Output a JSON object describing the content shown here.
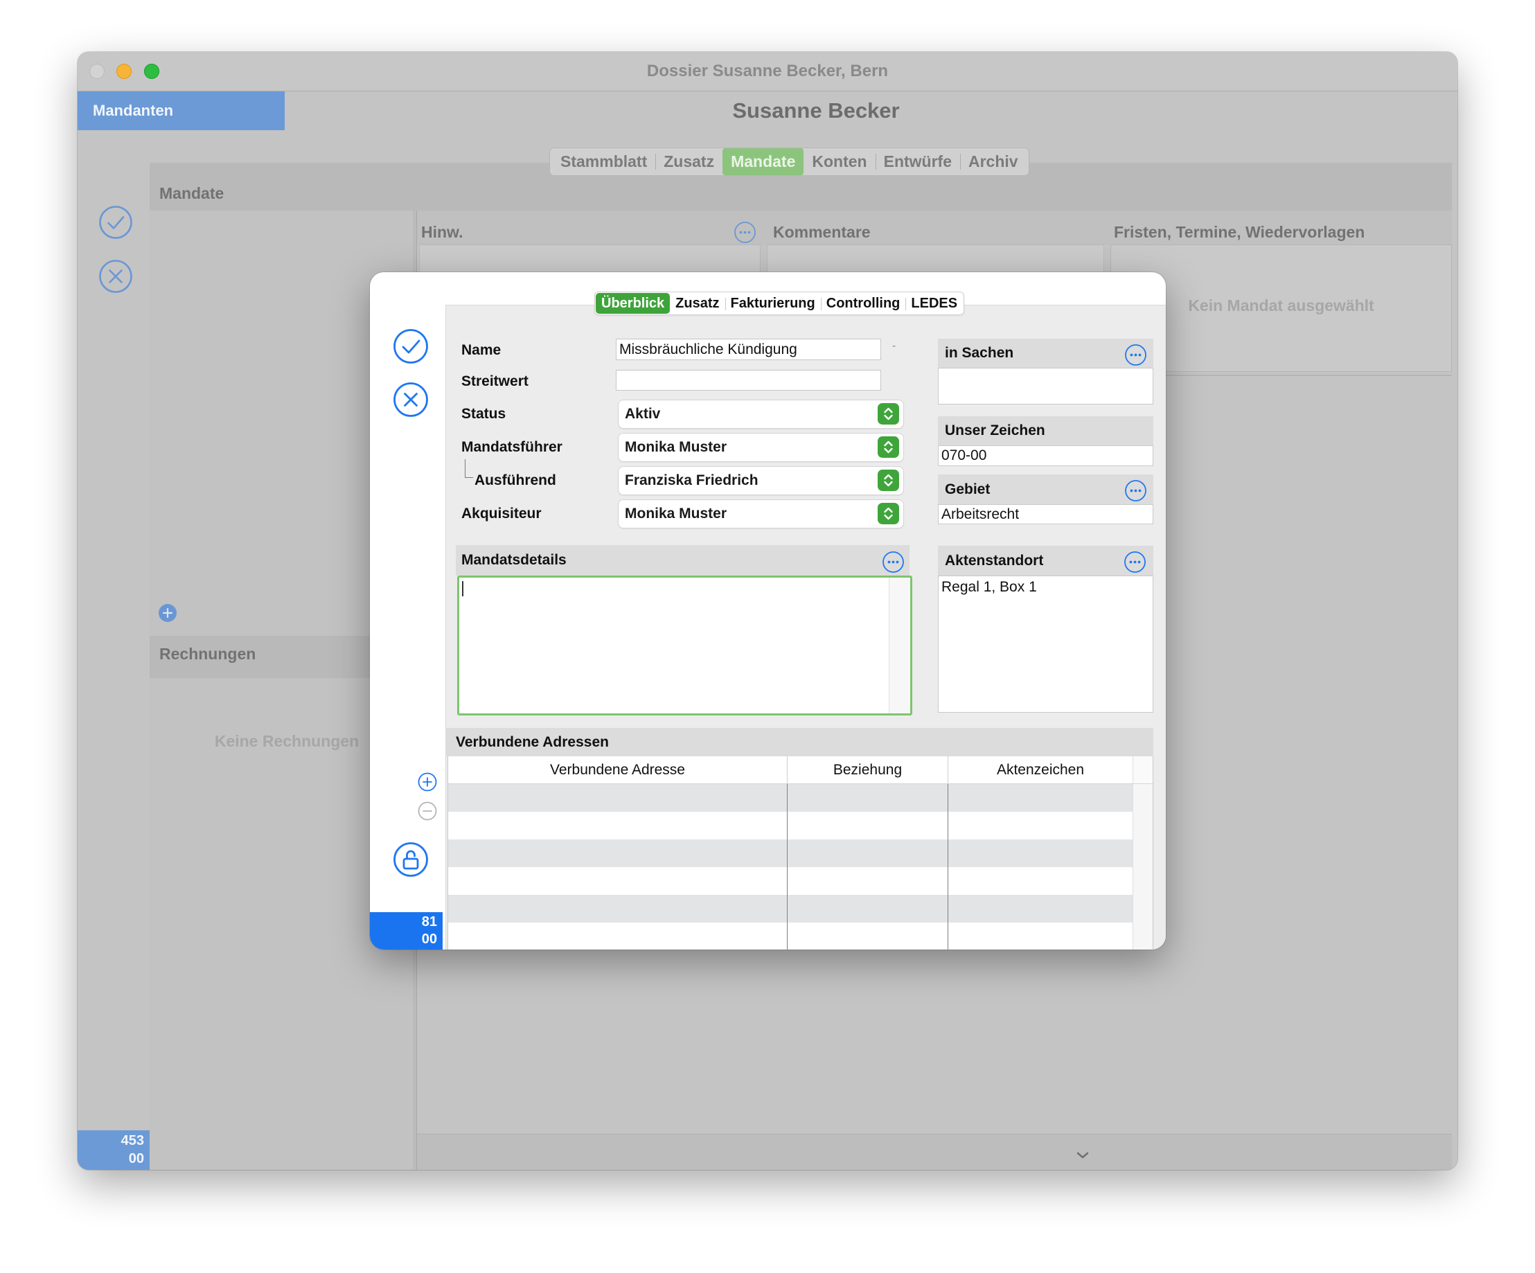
{
  "window": {
    "title": "Dossier Susanne Becker, Bern"
  },
  "sidebar": {
    "tab_label": "Mandanten",
    "badge": {
      "line1": "453",
      "line2": "00"
    }
  },
  "header": {
    "title": "Susanne Becker"
  },
  "main_tabs": [
    {
      "label": "Stammblatt",
      "selected": false
    },
    {
      "label": "Zusatz",
      "selected": false
    },
    {
      "label": "Mandate",
      "selected": true
    },
    {
      "label": "Konten",
      "selected": false
    },
    {
      "label": "Entwürfe",
      "selected": false
    },
    {
      "label": "Archiv",
      "selected": false
    }
  ],
  "mandate_panel": {
    "title": "Mandate"
  },
  "invoices_panel": {
    "title": "Rechnungen",
    "empty_text": "Keine Rechnungen"
  },
  "detail_sections": {
    "hints": "Hinw.",
    "comments": "Kommentare",
    "deadlines": "Fristen, Termine, Wiedervorlagen",
    "empty_text": "Kein Mandat ausgewählt"
  },
  "modal": {
    "tabs": [
      {
        "label": "Überblick",
        "selected": true
      },
      {
        "label": "Zusatz",
        "selected": false
      },
      {
        "label": "Fakturierung",
        "selected": false
      },
      {
        "label": "Controlling",
        "selected": false
      },
      {
        "label": "LEDES",
        "selected": false
      }
    ],
    "badge": {
      "line1": "81",
      "line2": "00"
    },
    "form": {
      "name": {
        "label": "Name",
        "value": "Missbräuchliche Kündigung",
        "suffix": "-"
      },
      "streitwert": {
        "label": "Streitwert",
        "value": ""
      },
      "status": {
        "label": "Status",
        "value": "Aktiv"
      },
      "mandatsfuehrer": {
        "label": "Mandatsführer",
        "value": "Monika Muster"
      },
      "ausfuehrend": {
        "label": "Ausführend",
        "value": "Franziska Friedrich"
      },
      "akquisiteur": {
        "label": "Akquisiteur",
        "value": "Monika Muster"
      }
    },
    "details": {
      "label": "Mandatsdetails",
      "value": ""
    },
    "in_sachen": {
      "label": "in Sachen",
      "value": ""
    },
    "unser_zeichen": {
      "label": "Unser Zeichen",
      "value": "070-00"
    },
    "gebiet": {
      "label": "Gebiet",
      "value": "Arbeitsrecht"
    },
    "aktenstandort": {
      "label": "Aktenstandort",
      "value": "Regal 1, Box 1"
    },
    "linked_addresses": {
      "title": "Verbundene Adressen",
      "columns": [
        "Verbundene Adresse",
        "Beziehung",
        "Aktenzeichen"
      ]
    }
  },
  "icons": {
    "confirm": "check-circle-icon",
    "cancel": "x-circle-icon",
    "more": "ellipsis-circle-icon",
    "add": "plus-circle-icon",
    "remove": "minus-circle-icon",
    "lock": "lock-open-icon",
    "popup_stepper": "up-down-stepper-icon",
    "expand": "chevron-down-icon"
  },
  "colors": {
    "accent_green": "#3ea43a",
    "selection_blue": "#1a74ef",
    "icon_blue": "#1f77f2",
    "sidebar_blue_dimmed": "#6b9ad6",
    "focus_ring_green": "#7dc46e"
  }
}
